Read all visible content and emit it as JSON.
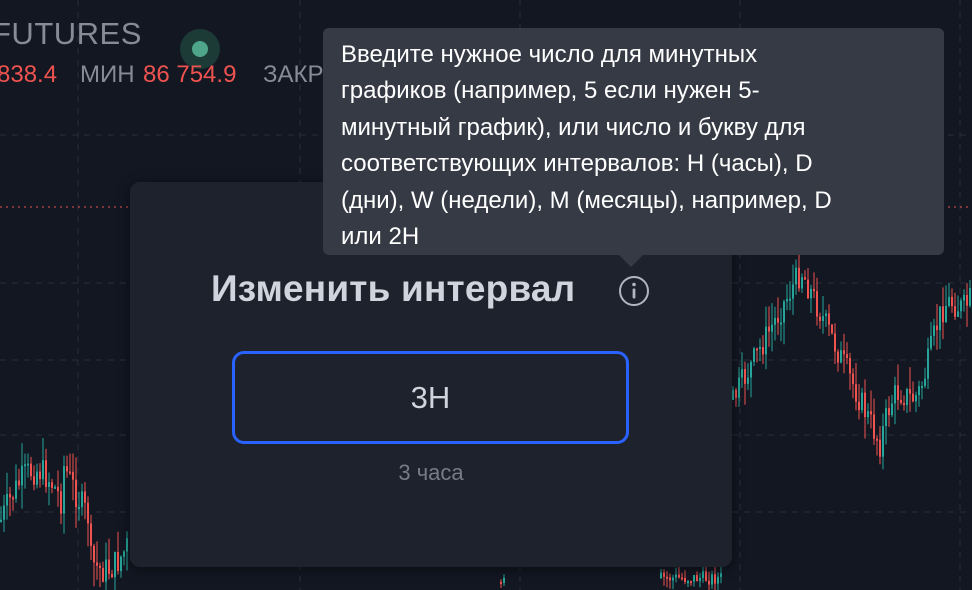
{
  "header": {
    "symbol_title": "FUTURES",
    "ohlc": {
      "high_value_partial": "838.4",
      "low_label": "МИН",
      "low_value": "86 754.9",
      "close_label_partial": "ЗАКР"
    }
  },
  "dialog": {
    "title": "Изменить интервал",
    "input_value": "3H",
    "hint": "3 часа"
  },
  "tooltip": {
    "lines": [
      "Введите нужное число для минутных",
      "графиков (например, 5 если нужен 5-",
      "минутный график), или число и букву для",
      "соответствующих интервалов: H (часы), D",
      "(дни), W (недели), M (месяцы), например, D",
      "или 2H"
    ]
  },
  "colors": {
    "background": "#131722",
    "candle_up": "#26a69a",
    "candle_down": "#ef5350",
    "accent": "#2962ff",
    "dialog_bg": "#1e222d",
    "tooltip_bg": "#363a45"
  },
  "icons": {
    "info": "info-circle-icon",
    "status": "status-dot-icon"
  }
}
